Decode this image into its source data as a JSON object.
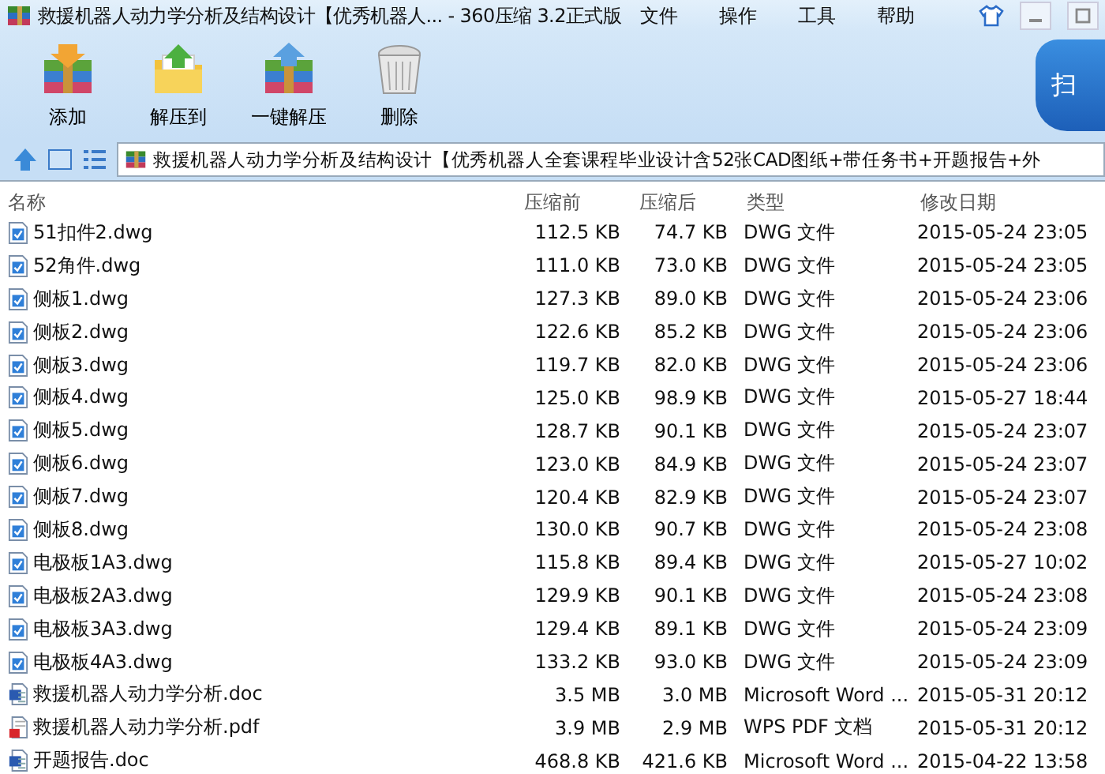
{
  "window": {
    "title": "救援机器人动力学分析及结构设计【优秀机器人... - 360压缩 3.2正式版"
  },
  "menu": [
    "文件",
    "操作",
    "工具",
    "帮助"
  ],
  "toolbar": [
    {
      "label": "添加",
      "kind": "add"
    },
    {
      "label": "解压到",
      "kind": "extract"
    },
    {
      "label": "一键解压",
      "kind": "oneclick"
    },
    {
      "label": "删除",
      "kind": "delete"
    }
  ],
  "scan_button": {
    "label": "扫"
  },
  "address": {
    "value": "救援机器人动力学分析及结构设计【优秀机器人全套课程毕业设计含52张CAD图纸+带任务书+开题报告+外"
  },
  "table": {
    "columns": [
      "名称",
      "压缩前",
      "压缩后",
      "类型",
      "修改日期"
    ],
    "rows": [
      {
        "kind": "dwg",
        "name": "51扣件2.dwg",
        "before": "112.5 KB",
        "after": "74.7 KB",
        "type": "DWG 文件",
        "date": "2015-05-24 23:05"
      },
      {
        "kind": "dwg",
        "name": "52角件.dwg",
        "before": "111.0 KB",
        "after": "73.0 KB",
        "type": "DWG 文件",
        "date": "2015-05-24 23:05"
      },
      {
        "kind": "dwg",
        "name": "侧板1.dwg",
        "before": "127.3 KB",
        "after": "89.0 KB",
        "type": "DWG 文件",
        "date": "2015-05-24 23:06"
      },
      {
        "kind": "dwg",
        "name": "侧板2.dwg",
        "before": "122.6 KB",
        "after": "85.2 KB",
        "type": "DWG 文件",
        "date": "2015-05-24 23:06"
      },
      {
        "kind": "dwg",
        "name": "侧板3.dwg",
        "before": "119.7 KB",
        "after": "82.0 KB",
        "type": "DWG 文件",
        "date": "2015-05-24 23:06"
      },
      {
        "kind": "dwg",
        "name": "侧板4.dwg",
        "before": "125.0 KB",
        "after": "98.9 KB",
        "type": "DWG 文件",
        "date": "2015-05-27 18:44"
      },
      {
        "kind": "dwg",
        "name": "侧板5.dwg",
        "before": "128.7 KB",
        "after": "90.1 KB",
        "type": "DWG 文件",
        "date": "2015-05-24 23:07"
      },
      {
        "kind": "dwg",
        "name": "侧板6.dwg",
        "before": "123.0 KB",
        "after": "84.9 KB",
        "type": "DWG 文件",
        "date": "2015-05-24 23:07"
      },
      {
        "kind": "dwg",
        "name": "侧板7.dwg",
        "before": "120.4 KB",
        "after": "82.9 KB",
        "type": "DWG 文件",
        "date": "2015-05-24 23:07"
      },
      {
        "kind": "dwg",
        "name": "侧板8.dwg",
        "before": "130.0 KB",
        "after": "90.7 KB",
        "type": "DWG 文件",
        "date": "2015-05-24 23:08"
      },
      {
        "kind": "dwg",
        "name": "电极板1A3.dwg",
        "before": "115.8 KB",
        "after": "89.4 KB",
        "type": "DWG 文件",
        "date": "2015-05-27 10:02"
      },
      {
        "kind": "dwg",
        "name": "电极板2A3.dwg",
        "before": "129.9 KB",
        "after": "90.1 KB",
        "type": "DWG 文件",
        "date": "2015-05-24 23:08"
      },
      {
        "kind": "dwg",
        "name": "电极板3A3.dwg",
        "before": "129.4 KB",
        "after": "89.1 KB",
        "type": "DWG 文件",
        "date": "2015-05-24 23:09"
      },
      {
        "kind": "dwg",
        "name": "电极板4A3.dwg",
        "before": "133.2 KB",
        "after": "93.0 KB",
        "type": "DWG 文件",
        "date": "2015-05-24 23:09"
      },
      {
        "kind": "doc",
        "name": "救援机器人动力学分析.doc",
        "before": "3.5 MB",
        "after": "3.0 MB",
        "type": "Microsoft Word ...",
        "date": "2015-05-31 20:12"
      },
      {
        "kind": "pdf",
        "name": "救援机器人动力学分析.pdf",
        "before": "3.9 MB",
        "after": "2.9 MB",
        "type": "WPS PDF 文档",
        "date": "2015-05-31 20:12"
      },
      {
        "kind": "doc",
        "name": "开题报告.doc",
        "before": "468.8 KB",
        "after": "421.6 KB",
        "type": "Microsoft Word ...",
        "date": "2015-04-22 13:58"
      }
    ]
  }
}
